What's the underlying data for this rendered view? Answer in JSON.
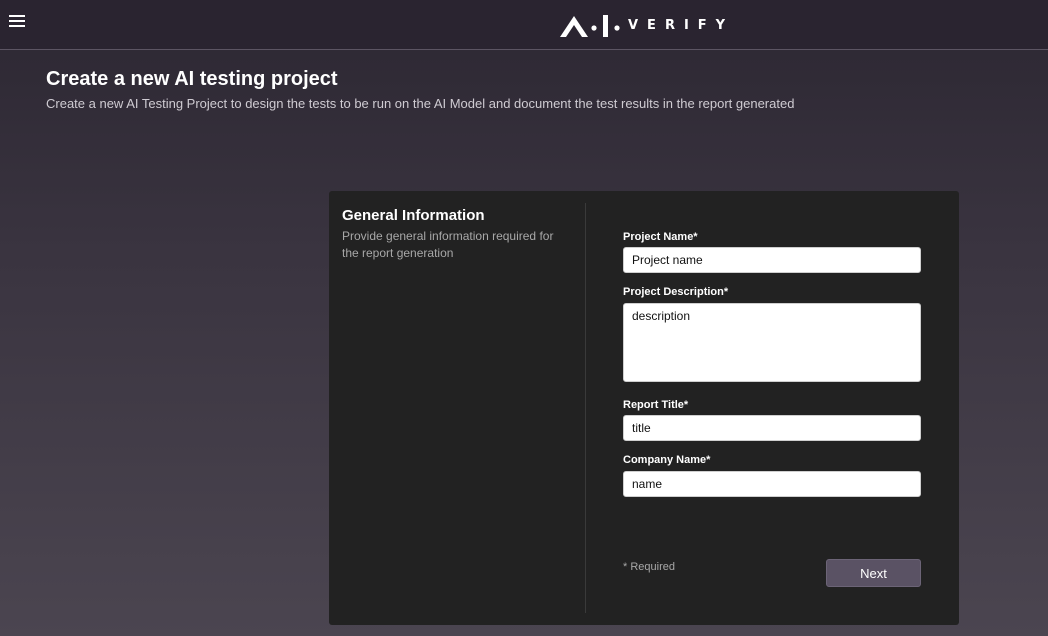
{
  "header": {
    "menu_icon": "hamburger-menu-icon",
    "logo_word": "VERIFY",
    "logo_mark": "ai-verify-logo-mark"
  },
  "page": {
    "title": "Create a new AI testing project",
    "subtitle": "Create a new AI Testing Project to design the tests to be run on the AI Model and document the test results in the report generated"
  },
  "form": {
    "section_title": "General Information",
    "section_description": "Provide general information required for the report generation",
    "fields": {
      "project_name": {
        "label": "Project Name*",
        "value": "Project name"
      },
      "project_description": {
        "label": "Project Description*",
        "value": "description"
      },
      "report_title": {
        "label": "Report Title*",
        "value": "title"
      },
      "company_name": {
        "label": "Company Name*",
        "value": "name"
      }
    },
    "required_note": "* Required",
    "next_label": "Next"
  },
  "colors": {
    "topbar": "#2a2430",
    "card": "#222222",
    "button": "#5a5264"
  }
}
